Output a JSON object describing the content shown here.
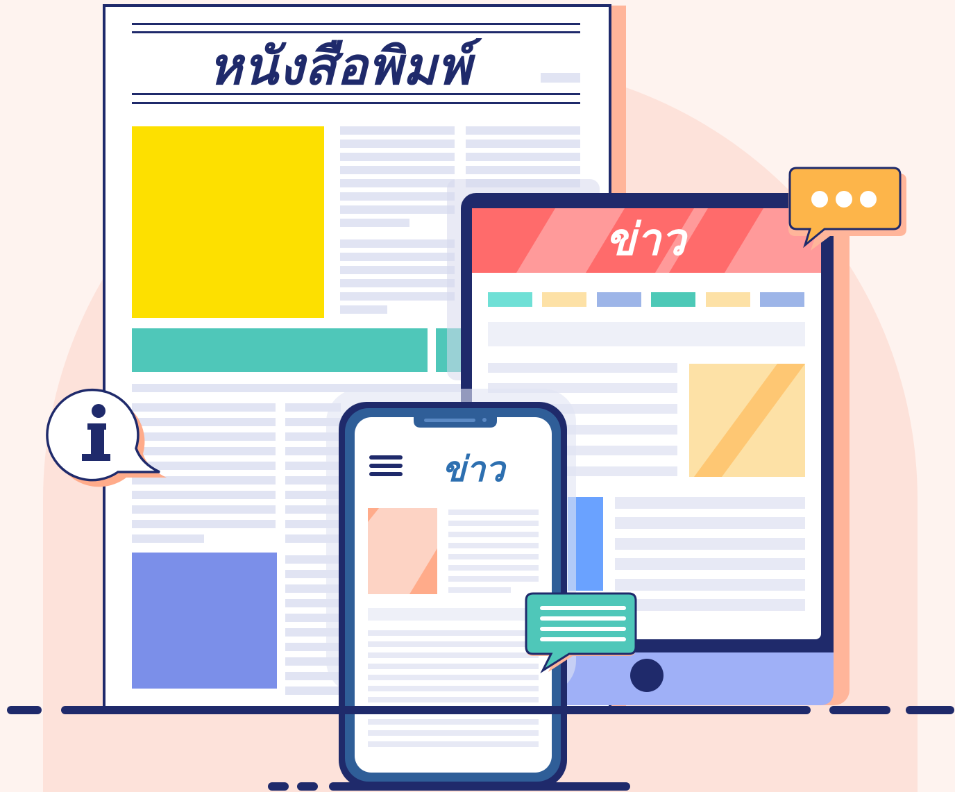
{
  "scene": {
    "newspaper": {
      "title": "หนังสือพิมพ์"
    },
    "tablet": {
      "header_title": "ข่าว",
      "chip_colors": [
        "#6fe0d6",
        "#fde1a6",
        "#9db5e8",
        "#4dc9b7",
        "#fde1a6",
        "#9db5e8"
      ]
    },
    "phone": {
      "header_title": "ข่าว"
    },
    "info_bubble": {
      "glyph": "i",
      "icon": "info-icon"
    },
    "chat_bubbles": {
      "ellipsis_icon": "chat-ellipsis-icon",
      "text_icon": "chat-lines-icon"
    },
    "colors": {
      "background": "#fef3ef",
      "navy": "#1f2a6b",
      "yellow": "#fde000",
      "teal": "#4fc7b9",
      "periwinkle": "#7b8fe9",
      "coral": "#ff6b6b",
      "orange_bubble": "#fdb54a",
      "tablet_base": "#9fb0f7"
    }
  }
}
